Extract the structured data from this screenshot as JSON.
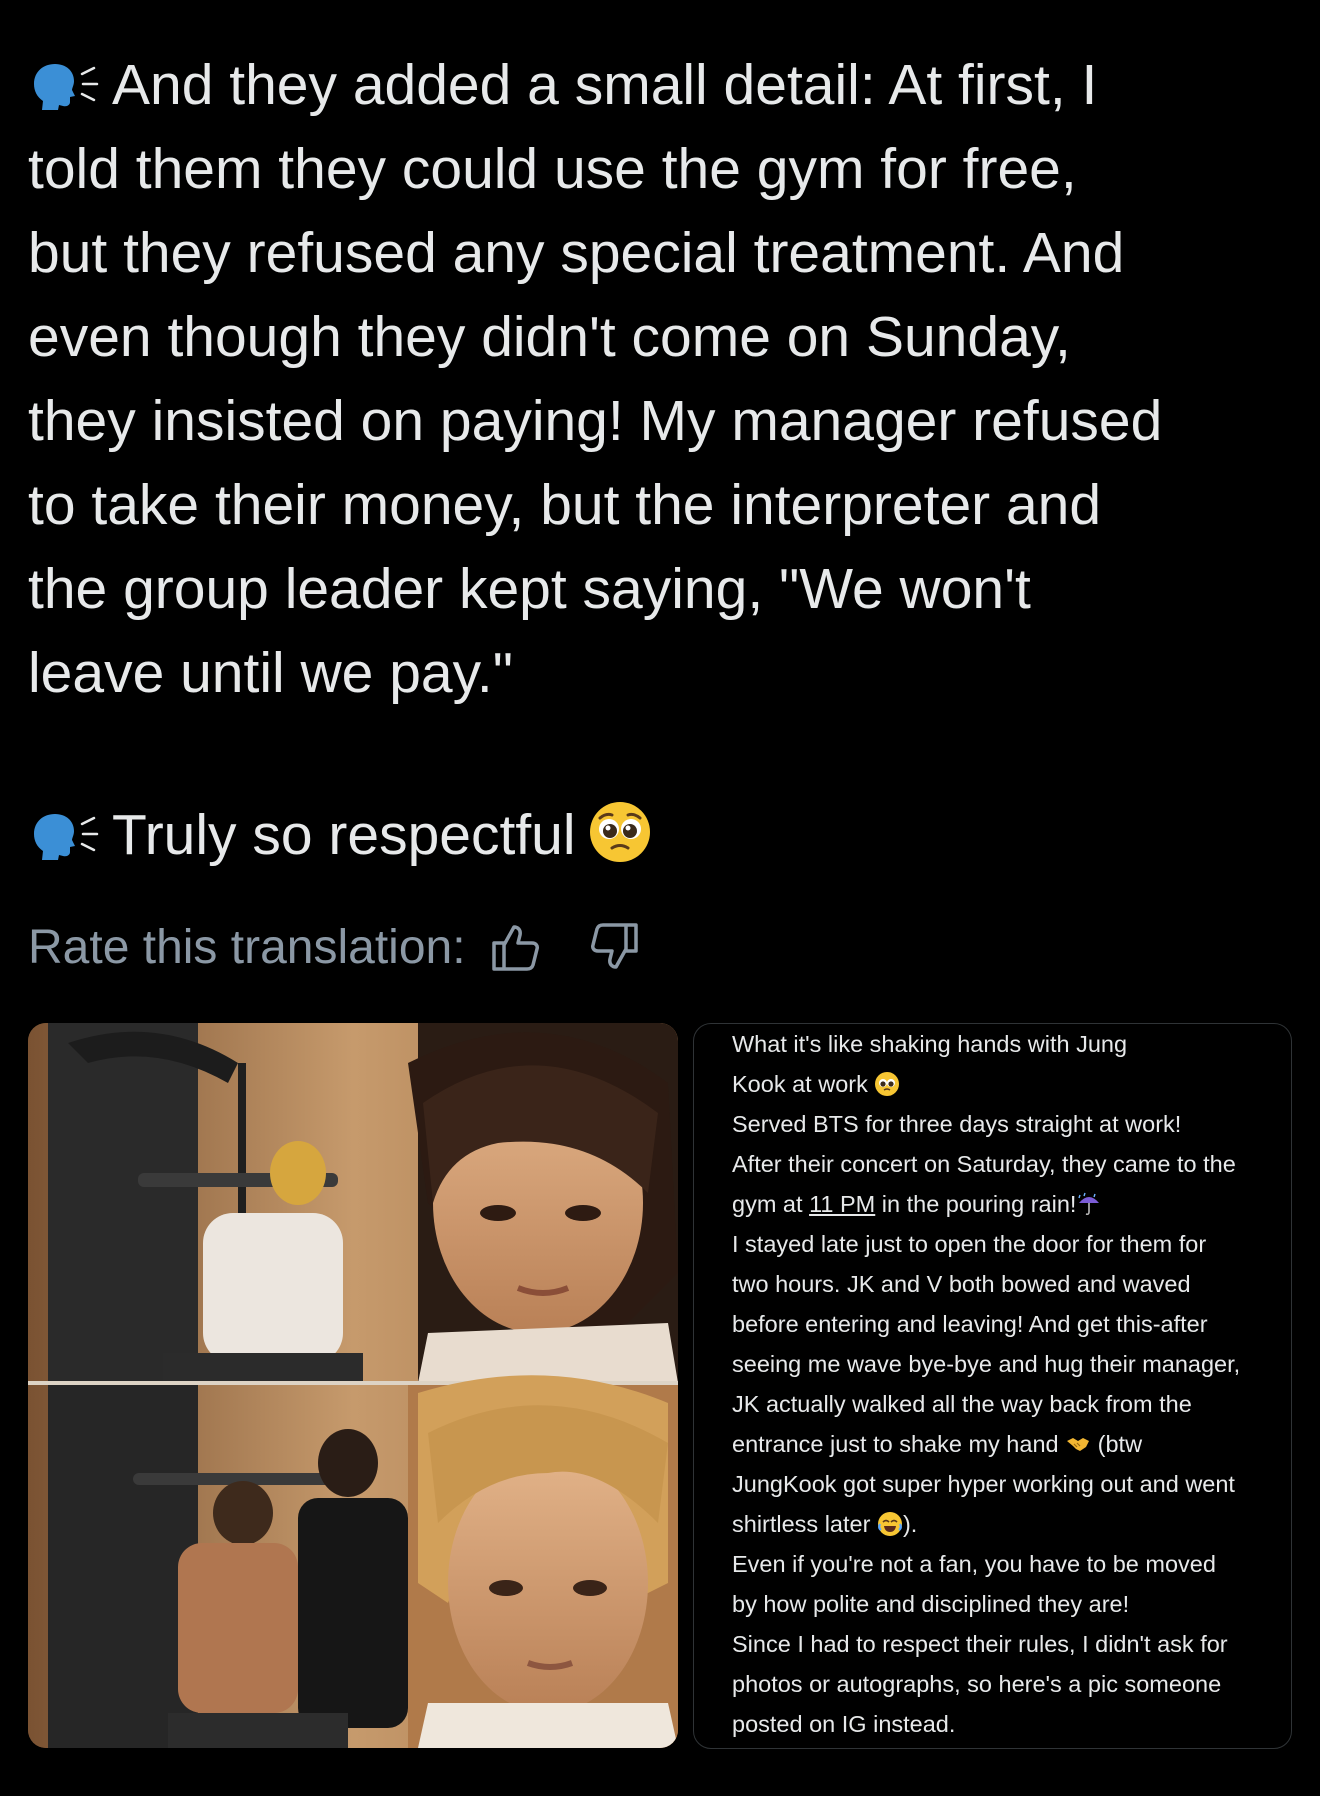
{
  "post": {
    "paragraph1_lines": [
      "And they added a small detail: At first, I",
      "told them they could use the gym for free,",
      "but they refused any special treatment. And",
      "even though they didn't come on Sunday,",
      "they insisted on paying! My manager refused",
      "to take their money, but the interpreter and",
      "the group leader kept saying, \"We won't",
      "leave until we pay.\""
    ],
    "paragraph2": "Truly so respectful",
    "icons": [
      "speaking-head-icon",
      "pleading-face-emoji-icon"
    ]
  },
  "rating": {
    "label": "Rate this translation:",
    "up_icon": "thumbs-up-icon",
    "down_icon": "thumbs-down-icon"
  },
  "media": {
    "photo_icon": "collage-photo-gym",
    "card_lines": [
      "What it's like shaking hands with Jung",
      "Kook at work",
      "Served BTS for three days straight at work!",
      "After their concert on Saturday, they came to the",
      "gym at 11 PM in the pouring rain!",
      "I stayed late just to open the door for them for",
      "two hours. JK and V both bowed and waved",
      "before entering and leaving! And get this-after",
      "seeing me wave bye-bye and hug their manager,",
      "JK actually walked all the way back from the",
      "entrance just to shake my hand",
      "JungKook got super hyper working out and went",
      "shirtless later",
      "Even if you're not a fan, you have to be moved",
      "by how polite and disciplined they are!",
      "Since I had to respect their rules, I didn't ask for",
      "photos or autographs, so here's a pic someone",
      "posted on IG instead."
    ],
    "card_inline": {
      "gym_at": "gym at ",
      "time": "11 PM",
      "rain_suffix": " in the pouring rain!",
      "btw": "(btw",
      "close": ")."
    }
  }
}
